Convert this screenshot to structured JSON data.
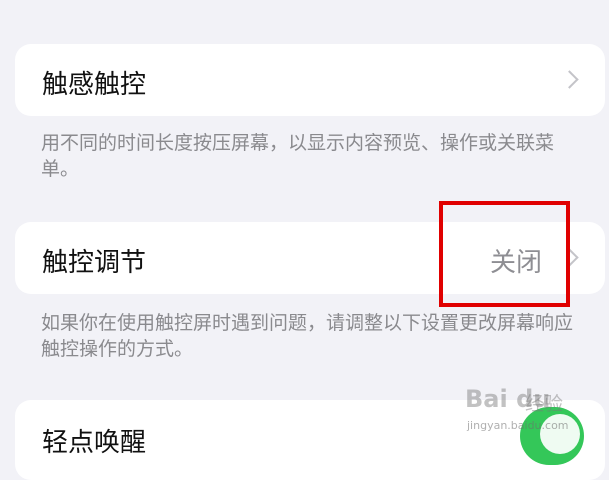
{
  "haptic_touch": {
    "label": "触感触控",
    "footnote": "用不同的时间长度按压屏幕，以显示内容预览、操作或关联菜单。"
  },
  "touch_accommodations": {
    "label": "触控调节",
    "value": "关闭",
    "footnote": "如果你在使用触控屏时遇到问题，请调整以下设置更改屏幕响应触控操作的方式。"
  },
  "tap_to_wake": {
    "label": "轻点唤醒",
    "enabled": true
  },
  "watermark": {
    "logo": "Bai du",
    "sub": "经验",
    "url": "jingyan.baidu.com"
  },
  "colors": {
    "background": "#f2f2f7",
    "card": "#ffffff",
    "highlight": "#e00000",
    "toggle_on": "#34c759",
    "secondary_text": "#8a8a8e"
  }
}
